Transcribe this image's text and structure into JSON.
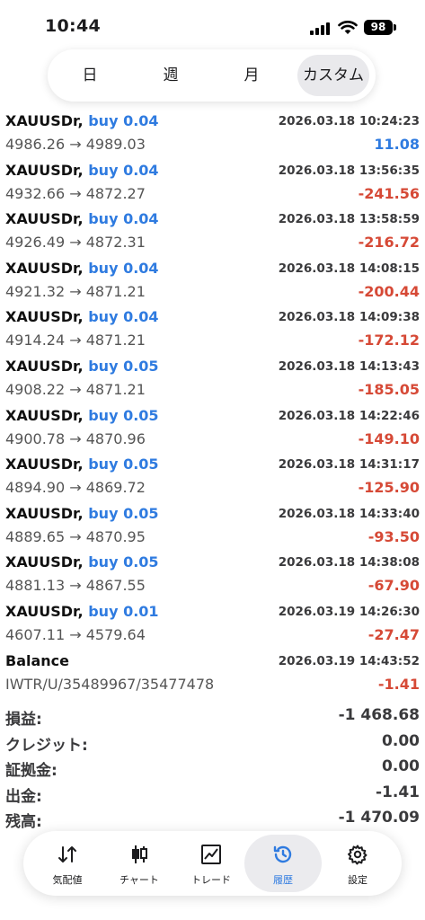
{
  "status_bar": {
    "time": "10:44",
    "battery": "98"
  },
  "tabs": [
    {
      "label": "日"
    },
    {
      "label": "週"
    },
    {
      "label": "月"
    },
    {
      "label": "カスタム",
      "active": true
    }
  ],
  "trades": [
    {
      "symbol": "XAUUSDr,",
      "side": "buy 0.04",
      "datetime": "2026.03.18 10:24:23",
      "prices": "4986.26 → 4989.03",
      "profit": "11.08",
      "sign": "pos"
    },
    {
      "symbol": "XAUUSDr,",
      "side": "buy 0.04",
      "datetime": "2026.03.18 13:56:35",
      "prices": "4932.66 → 4872.27",
      "profit": "-241.56",
      "sign": "neg"
    },
    {
      "symbol": "XAUUSDr,",
      "side": "buy 0.04",
      "datetime": "2026.03.18 13:58:59",
      "prices": "4926.49 → 4872.31",
      "profit": "-216.72",
      "sign": "neg"
    },
    {
      "symbol": "XAUUSDr,",
      "side": "buy 0.04",
      "datetime": "2026.03.18 14:08:15",
      "prices": "4921.32 → 4871.21",
      "profit": "-200.44",
      "sign": "neg"
    },
    {
      "symbol": "XAUUSDr,",
      "side": "buy 0.04",
      "datetime": "2026.03.18 14:09:38",
      "prices": "4914.24 → 4871.21",
      "profit": "-172.12",
      "sign": "neg"
    },
    {
      "symbol": "XAUUSDr,",
      "side": "buy 0.05",
      "datetime": "2026.03.18 14:13:43",
      "prices": "4908.22 → 4871.21",
      "profit": "-185.05",
      "sign": "neg"
    },
    {
      "symbol": "XAUUSDr,",
      "side": "buy 0.05",
      "datetime": "2026.03.18 14:22:46",
      "prices": "4900.78 → 4870.96",
      "profit": "-149.10",
      "sign": "neg"
    },
    {
      "symbol": "XAUUSDr,",
      "side": "buy 0.05",
      "datetime": "2026.03.18 14:31:17",
      "prices": "4894.90 → 4869.72",
      "profit": "-125.90",
      "sign": "neg"
    },
    {
      "symbol": "XAUUSDr,",
      "side": "buy 0.05",
      "datetime": "2026.03.18 14:33:40",
      "prices": "4889.65 → 4870.95",
      "profit": "-93.50",
      "sign": "neg"
    },
    {
      "symbol": "XAUUSDr,",
      "side": "buy 0.05",
      "datetime": "2026.03.18 14:38:08",
      "prices": "4881.13 → 4867.55",
      "profit": "-67.90",
      "sign": "neg"
    },
    {
      "symbol": "XAUUSDr,",
      "side": "buy 0.01",
      "datetime": "2026.03.19 14:26:30",
      "prices": "4607.11 → 4579.64",
      "profit": "-27.47",
      "sign": "neg"
    },
    {
      "symbol": "Balance",
      "side": "",
      "datetime": "2026.03.19 14:43:52",
      "prices": "IWTR/U/35489967/35477478",
      "profit": "-1.41",
      "sign": "neg"
    }
  ],
  "summary": [
    {
      "label": "損益:",
      "value": "-1 468.68"
    },
    {
      "label": "クレジット:",
      "value": "0.00"
    },
    {
      "label": "証拠金:",
      "value": "0.00"
    },
    {
      "label": "出金:",
      "value": "-1.41"
    },
    {
      "label": "残高:",
      "value": "-1 470.09"
    }
  ],
  "nav": [
    {
      "label": "気配値",
      "icon": "quotes-icon"
    },
    {
      "label": "チャート",
      "icon": "candlestick-icon"
    },
    {
      "label": "トレード",
      "icon": "trade-chart-icon"
    },
    {
      "label": "履歴",
      "icon": "history-icon",
      "active": true
    },
    {
      "label": "設定",
      "icon": "settings-gear-icon"
    }
  ],
  "colors": {
    "accent": "#2f7be0",
    "loss": "#d64936",
    "text": "#1c1c1e"
  }
}
